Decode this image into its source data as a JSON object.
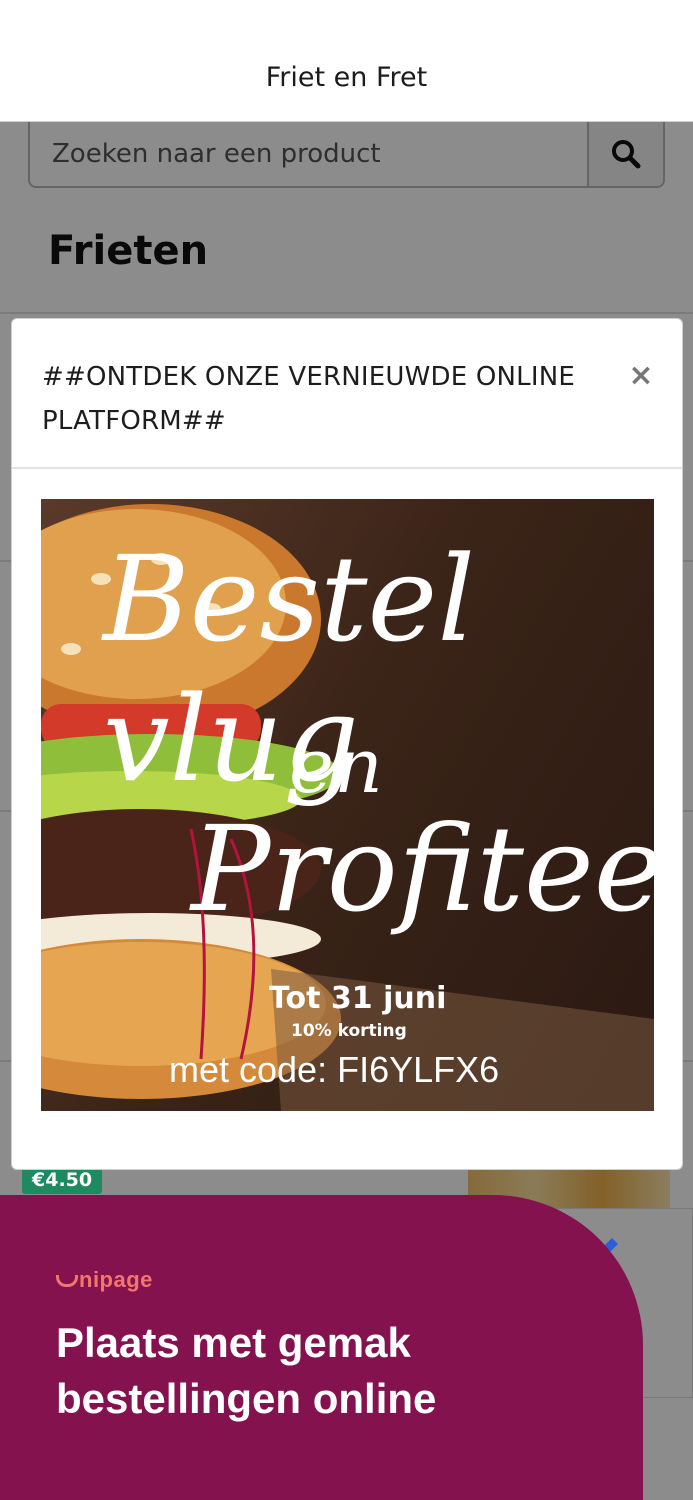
{
  "header": {
    "title": "Friet en Fret"
  },
  "search": {
    "placeholder": "Zoeken naar een product"
  },
  "category": {
    "title": "Frieten"
  },
  "product": {
    "price": "€4.50"
  },
  "modal": {
    "title": "##ONTDEK ONZE VERNIEUWDE ONLINE PLATFORM##",
    "close_symbol": "×",
    "promo": {
      "line1": "Bestel vlug",
      "line2": "en",
      "line3": "Profiteer",
      "until": "Tot 31 juni",
      "discount": "10% korting",
      "code": "met code: FI6YLFX6"
    }
  },
  "banner": {
    "brand": "nipage",
    "headline": "Plaats met gemak bestellingen online",
    "color": "#84124f",
    "brand_color": "#f2766c"
  }
}
